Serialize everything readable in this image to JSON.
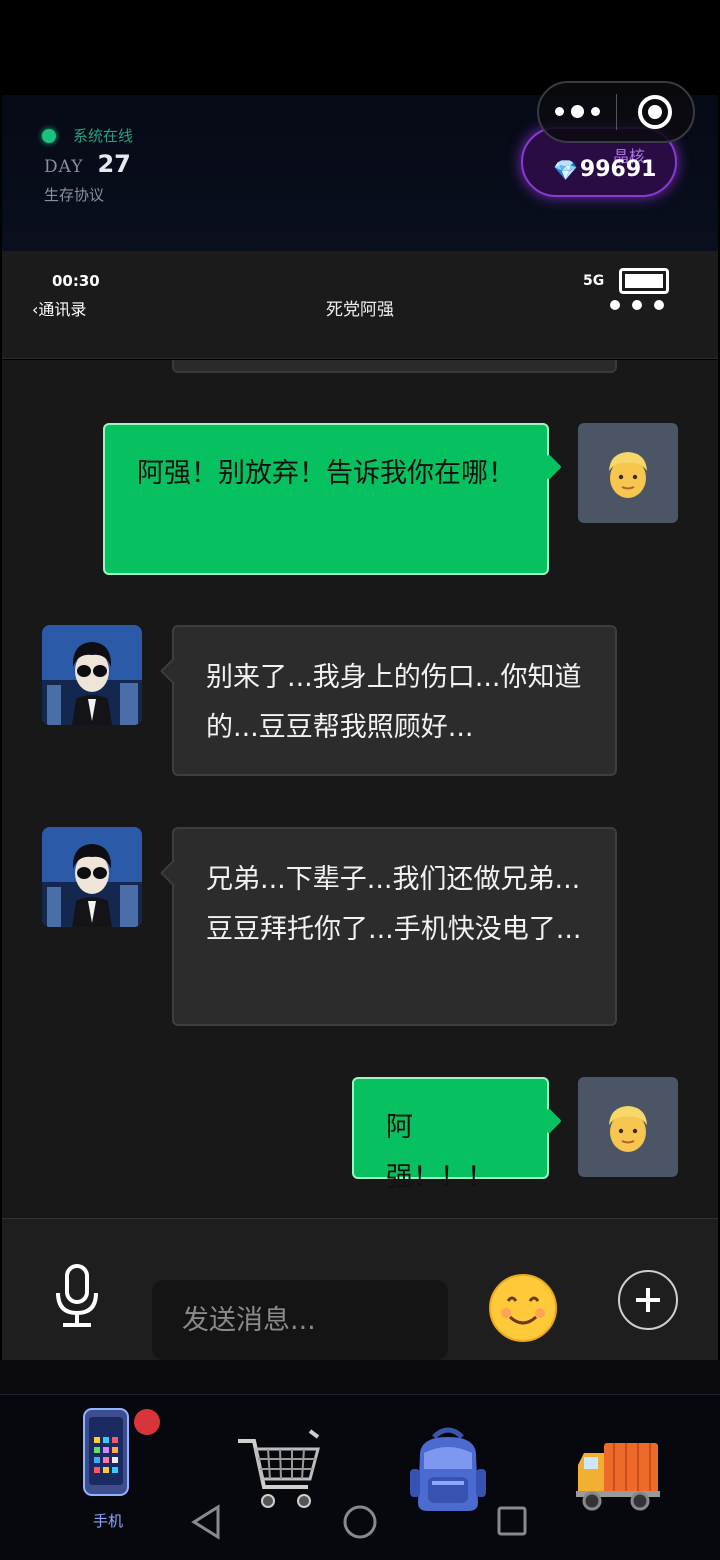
{
  "hud": {
    "status_text": "系统在线",
    "day_label": "DAY",
    "day_number": "27",
    "protocol": "生存协议",
    "crystal_label": "晶核",
    "crystal_value": "99691",
    "status_color": "#19c37d",
    "crystal_accent": "#8a3ad0"
  },
  "phone": {
    "time": "00:30",
    "network": "5G",
    "back_label": "通讯录",
    "chat_title": "死党阿强"
  },
  "messages": [
    {
      "from": "me",
      "text": "阿强！别放弃！告诉我你在哪！"
    },
    {
      "from": "contact",
      "text": "别来了...我身上的伤口...你知道的...豆豆帮我照顾好..."
    },
    {
      "from": "contact",
      "text": "兄弟...下辈子...我们还做兄弟...豆豆拜托你了...手机快没电了..."
    },
    {
      "from": "me",
      "text": "阿强！！！"
    }
  ],
  "input": {
    "placeholder": "发送消息..."
  },
  "nav": {
    "items": [
      {
        "label": "手机",
        "icon": "phone-icon",
        "active": true,
        "has_badge": true
      },
      {
        "label": "",
        "icon": "shopping-cart-icon"
      },
      {
        "label": "",
        "icon": "backpack-icon"
      },
      {
        "label": "",
        "icon": "delivery-truck-icon"
      }
    ]
  },
  "colors": {
    "my_bubble": "#07c160",
    "their_bubble": "#2c2c2c",
    "badge": "#d8353a"
  }
}
